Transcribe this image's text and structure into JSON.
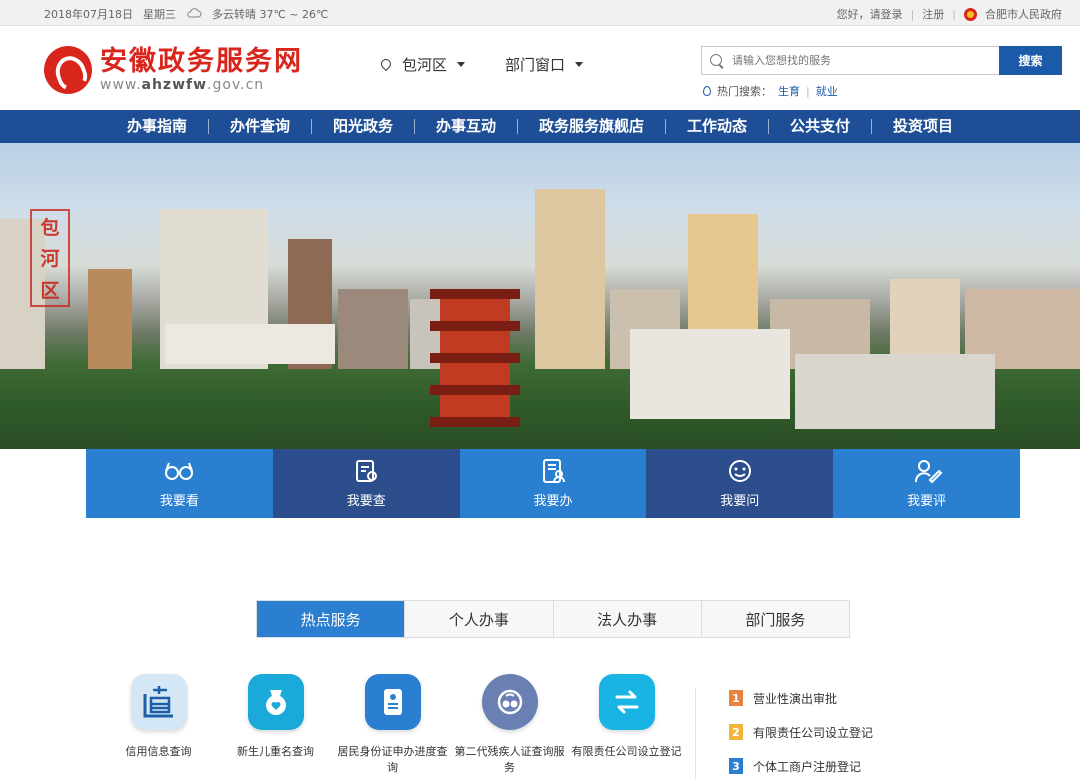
{
  "topbar": {
    "date": "2018年07月18日",
    "weekday": "星期三",
    "weather": "多云转晴 37℃ ~ 26℃",
    "greeting": "您好，",
    "login": "请登录",
    "register": "注册",
    "gov_link": "合肥市人民政府"
  },
  "header": {
    "site_name": "安徽政务服务网",
    "site_url_prefix": "www.",
    "site_url_bold": "ahzwfw",
    "site_url_suffix": ".gov.cn",
    "district": "包河区",
    "dept_window": "部门窗口",
    "search_placeholder": "请输入您想找的服务",
    "search_button": "搜索",
    "hot_label": "热门搜索：",
    "hot_terms": [
      "生育",
      "就业"
    ]
  },
  "nav": [
    "办事指南",
    "办件查询",
    "阳光政务",
    "办事互动",
    "政务服务旗舰店",
    "工作动态",
    "公共支付",
    "投资项目"
  ],
  "banner": {
    "stamp": [
      "包",
      "河",
      "区"
    ]
  },
  "quick": [
    "我要看",
    "我要查",
    "我要办",
    "我要问",
    "我要评"
  ],
  "tabs": [
    "热点服务",
    "个人办事",
    "法人办事",
    "部门服务"
  ],
  "services": [
    {
      "label": "信用信息查询",
      "color": "#cfe4f6",
      "icon": "credit-icon"
    },
    {
      "label": "新生儿重名查询",
      "color": "#1aa9d8",
      "icon": "baby-icon"
    },
    {
      "label": "居民身份证申办进度查询",
      "color": "#2a7fd1",
      "icon": "id-card-icon"
    },
    {
      "label": "第二代残疾人证查询服务",
      "color": "#6a80b2",
      "icon": "disability-icon"
    },
    {
      "label": "有限责任公司设立登记",
      "color": "#19b4e3",
      "icon": "transfer-icon"
    }
  ],
  "rank": [
    {
      "num": "1",
      "label": "营业性演出审批",
      "color": "#e8823f"
    },
    {
      "num": "2",
      "label": "有限责任公司设立登记",
      "color": "#f0b63c"
    },
    {
      "num": "3",
      "label": "个体工商户注册登记",
      "color": "#2a7fd1"
    }
  ]
}
